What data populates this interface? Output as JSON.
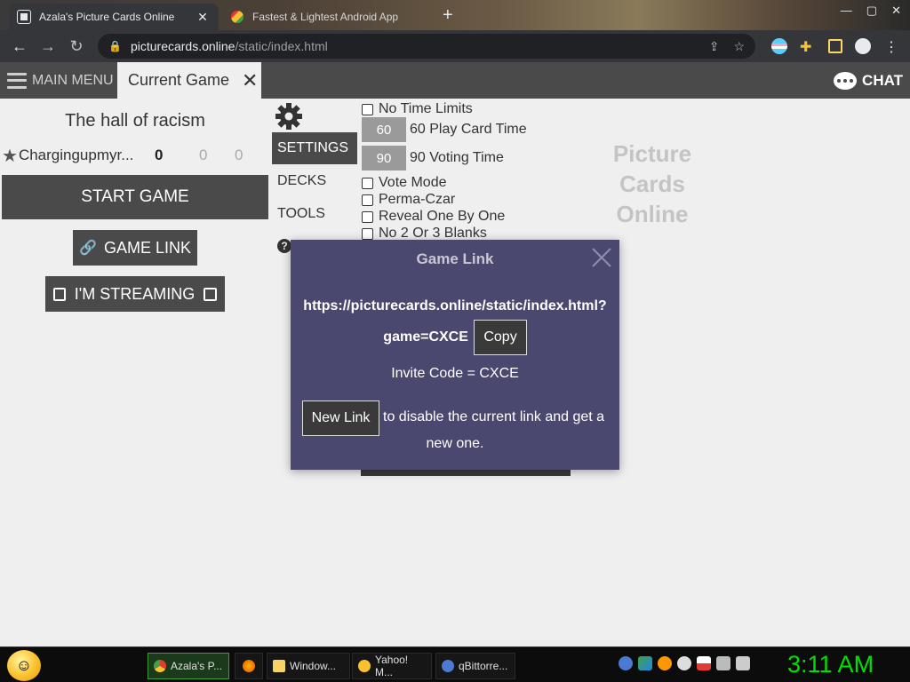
{
  "browser": {
    "tabs": [
      {
        "title": "Azala's Picture Cards Online",
        "active": true
      },
      {
        "title": "Fastest & Lightest Android App",
        "active": false
      }
    ],
    "new_tab": "+",
    "url_host": "picturecards.online",
    "url_path": "/static/index.html"
  },
  "header": {
    "main_menu": "MAIN MENU",
    "current_tab": "Current Game",
    "chat": "CHAT"
  },
  "game": {
    "name": "The hall of racism",
    "player": {
      "name": "Chargingupmyr...",
      "score1": "0",
      "score2": "0",
      "score3": "0"
    },
    "start_label": "START GAME",
    "game_link_label": "GAME LINK",
    "streaming_label": "I'M STREAMING"
  },
  "sidebar": {
    "settings": "SETTINGS",
    "decks": "DECKS",
    "tools": "TOOLS"
  },
  "options": {
    "no_time_limits": "No Time Limits",
    "play_time_value": "60",
    "play_time_label": "60 Play Card Time",
    "voting_time_value": "90",
    "voting_time_label": "90 Voting Time",
    "vote_mode": "Vote Mode",
    "perma_czar": "Perma-Czar",
    "reveal_one": "Reveal One By One",
    "no_blanks": "No 2 Or 3 Blanks"
  },
  "logo": {
    "line1": "Picture",
    "line2": "Cards",
    "line3": "Online"
  },
  "modal": {
    "title": "Game Link",
    "url": "https://picturecards.online/static/index.html?game=CXCE",
    "copy_label": "Copy",
    "invite_code": "Invite Code = CXCE",
    "new_link_label": "New Link",
    "new_link_text_a": "to disable the current link and get a",
    "new_link_text_b": "new one."
  },
  "taskbar": {
    "items": [
      "Azala's P...",
      "Window...",
      "Yahoo! M...",
      "qBittorre..."
    ],
    "clock": "3:11 AM"
  },
  "colors": {
    "header_bg": "#4a4a4a",
    "modal_bg": "#4b4870",
    "page_bg": "#efefef",
    "clock": "#00e000"
  }
}
